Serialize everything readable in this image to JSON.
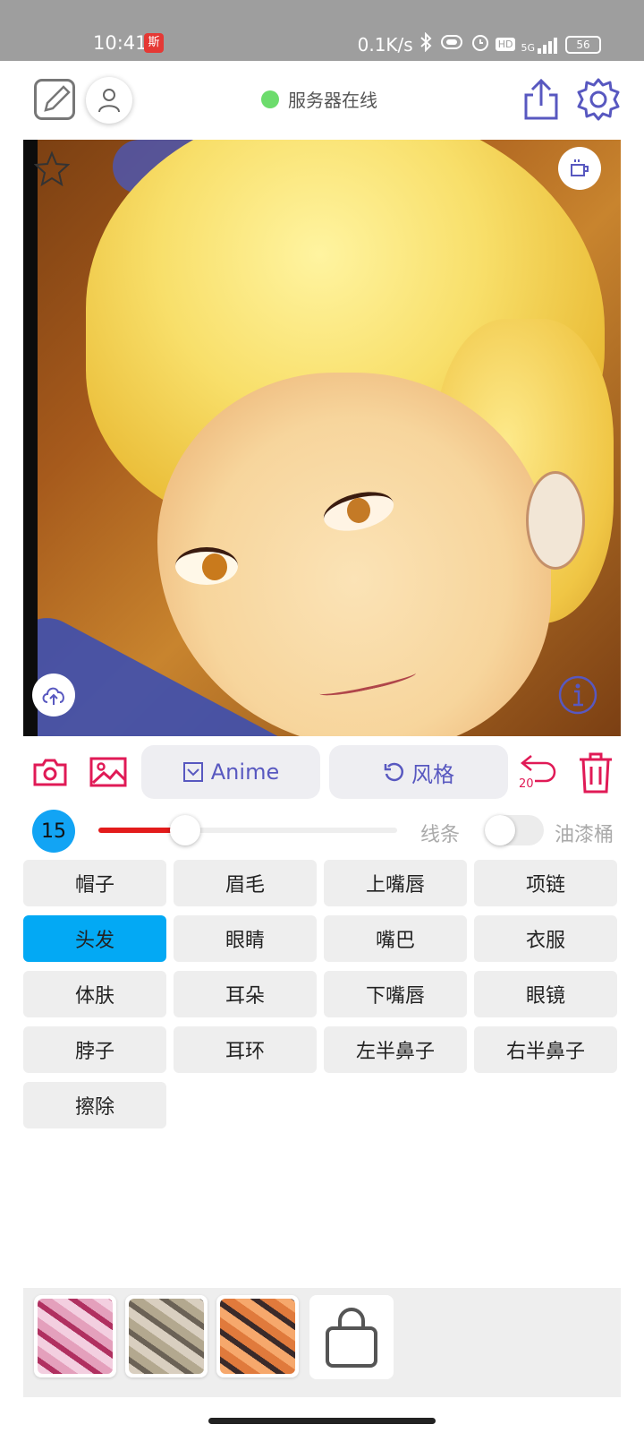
{
  "status_bar": {
    "time": "10:41",
    "badge_text": "斯",
    "network_speed": "0.1K/s",
    "signal_label": "5G",
    "hd_label": "HD",
    "battery": "56"
  },
  "toolbar": {
    "server_status": "服务器在线",
    "online_color": "#6cdc6c"
  },
  "tools": {
    "anime_label": "Anime",
    "style_label": "风格",
    "undo_count": "20"
  },
  "brush": {
    "size": "15",
    "slider_fraction": 0.29,
    "lines_label": "线条",
    "bucket_label": "油漆桶",
    "bucket_enabled": false
  },
  "parts": [
    {
      "label": "帽子"
    },
    {
      "label": "眉毛"
    },
    {
      "label": "上嘴唇"
    },
    {
      "label": "项链"
    },
    {
      "label": "头发",
      "active": true
    },
    {
      "label": "眼睛"
    },
    {
      "label": "嘴巴"
    },
    {
      "label": "衣服"
    },
    {
      "label": "体肤"
    },
    {
      "label": "耳朵"
    },
    {
      "label": "下嘴唇"
    },
    {
      "label": "眼镜"
    },
    {
      "label": "脖子"
    },
    {
      "label": "耳环"
    },
    {
      "label": "左半鼻子"
    },
    {
      "label": "右半鼻子"
    },
    {
      "label": "擦除"
    }
  ],
  "palette": {
    "swatches": [
      {
        "name": "pink-texture",
        "colors": [
          "#f3cfe0",
          "#b03060",
          "#e4a0bc"
        ]
      },
      {
        "name": "gray-texture",
        "colors": [
          "#d9cfc0",
          "#6b6256",
          "#b3a88f"
        ]
      },
      {
        "name": "orange-texture",
        "colors": [
          "#f6a86c",
          "#3a2a2a",
          "#e07a3c"
        ]
      }
    ]
  },
  "colors": {
    "accent": "#5858c0",
    "danger": "#e01a56",
    "active_part": "#03a9f4",
    "brush_badge": "#12a4f4",
    "slider": "#e31b1b"
  }
}
